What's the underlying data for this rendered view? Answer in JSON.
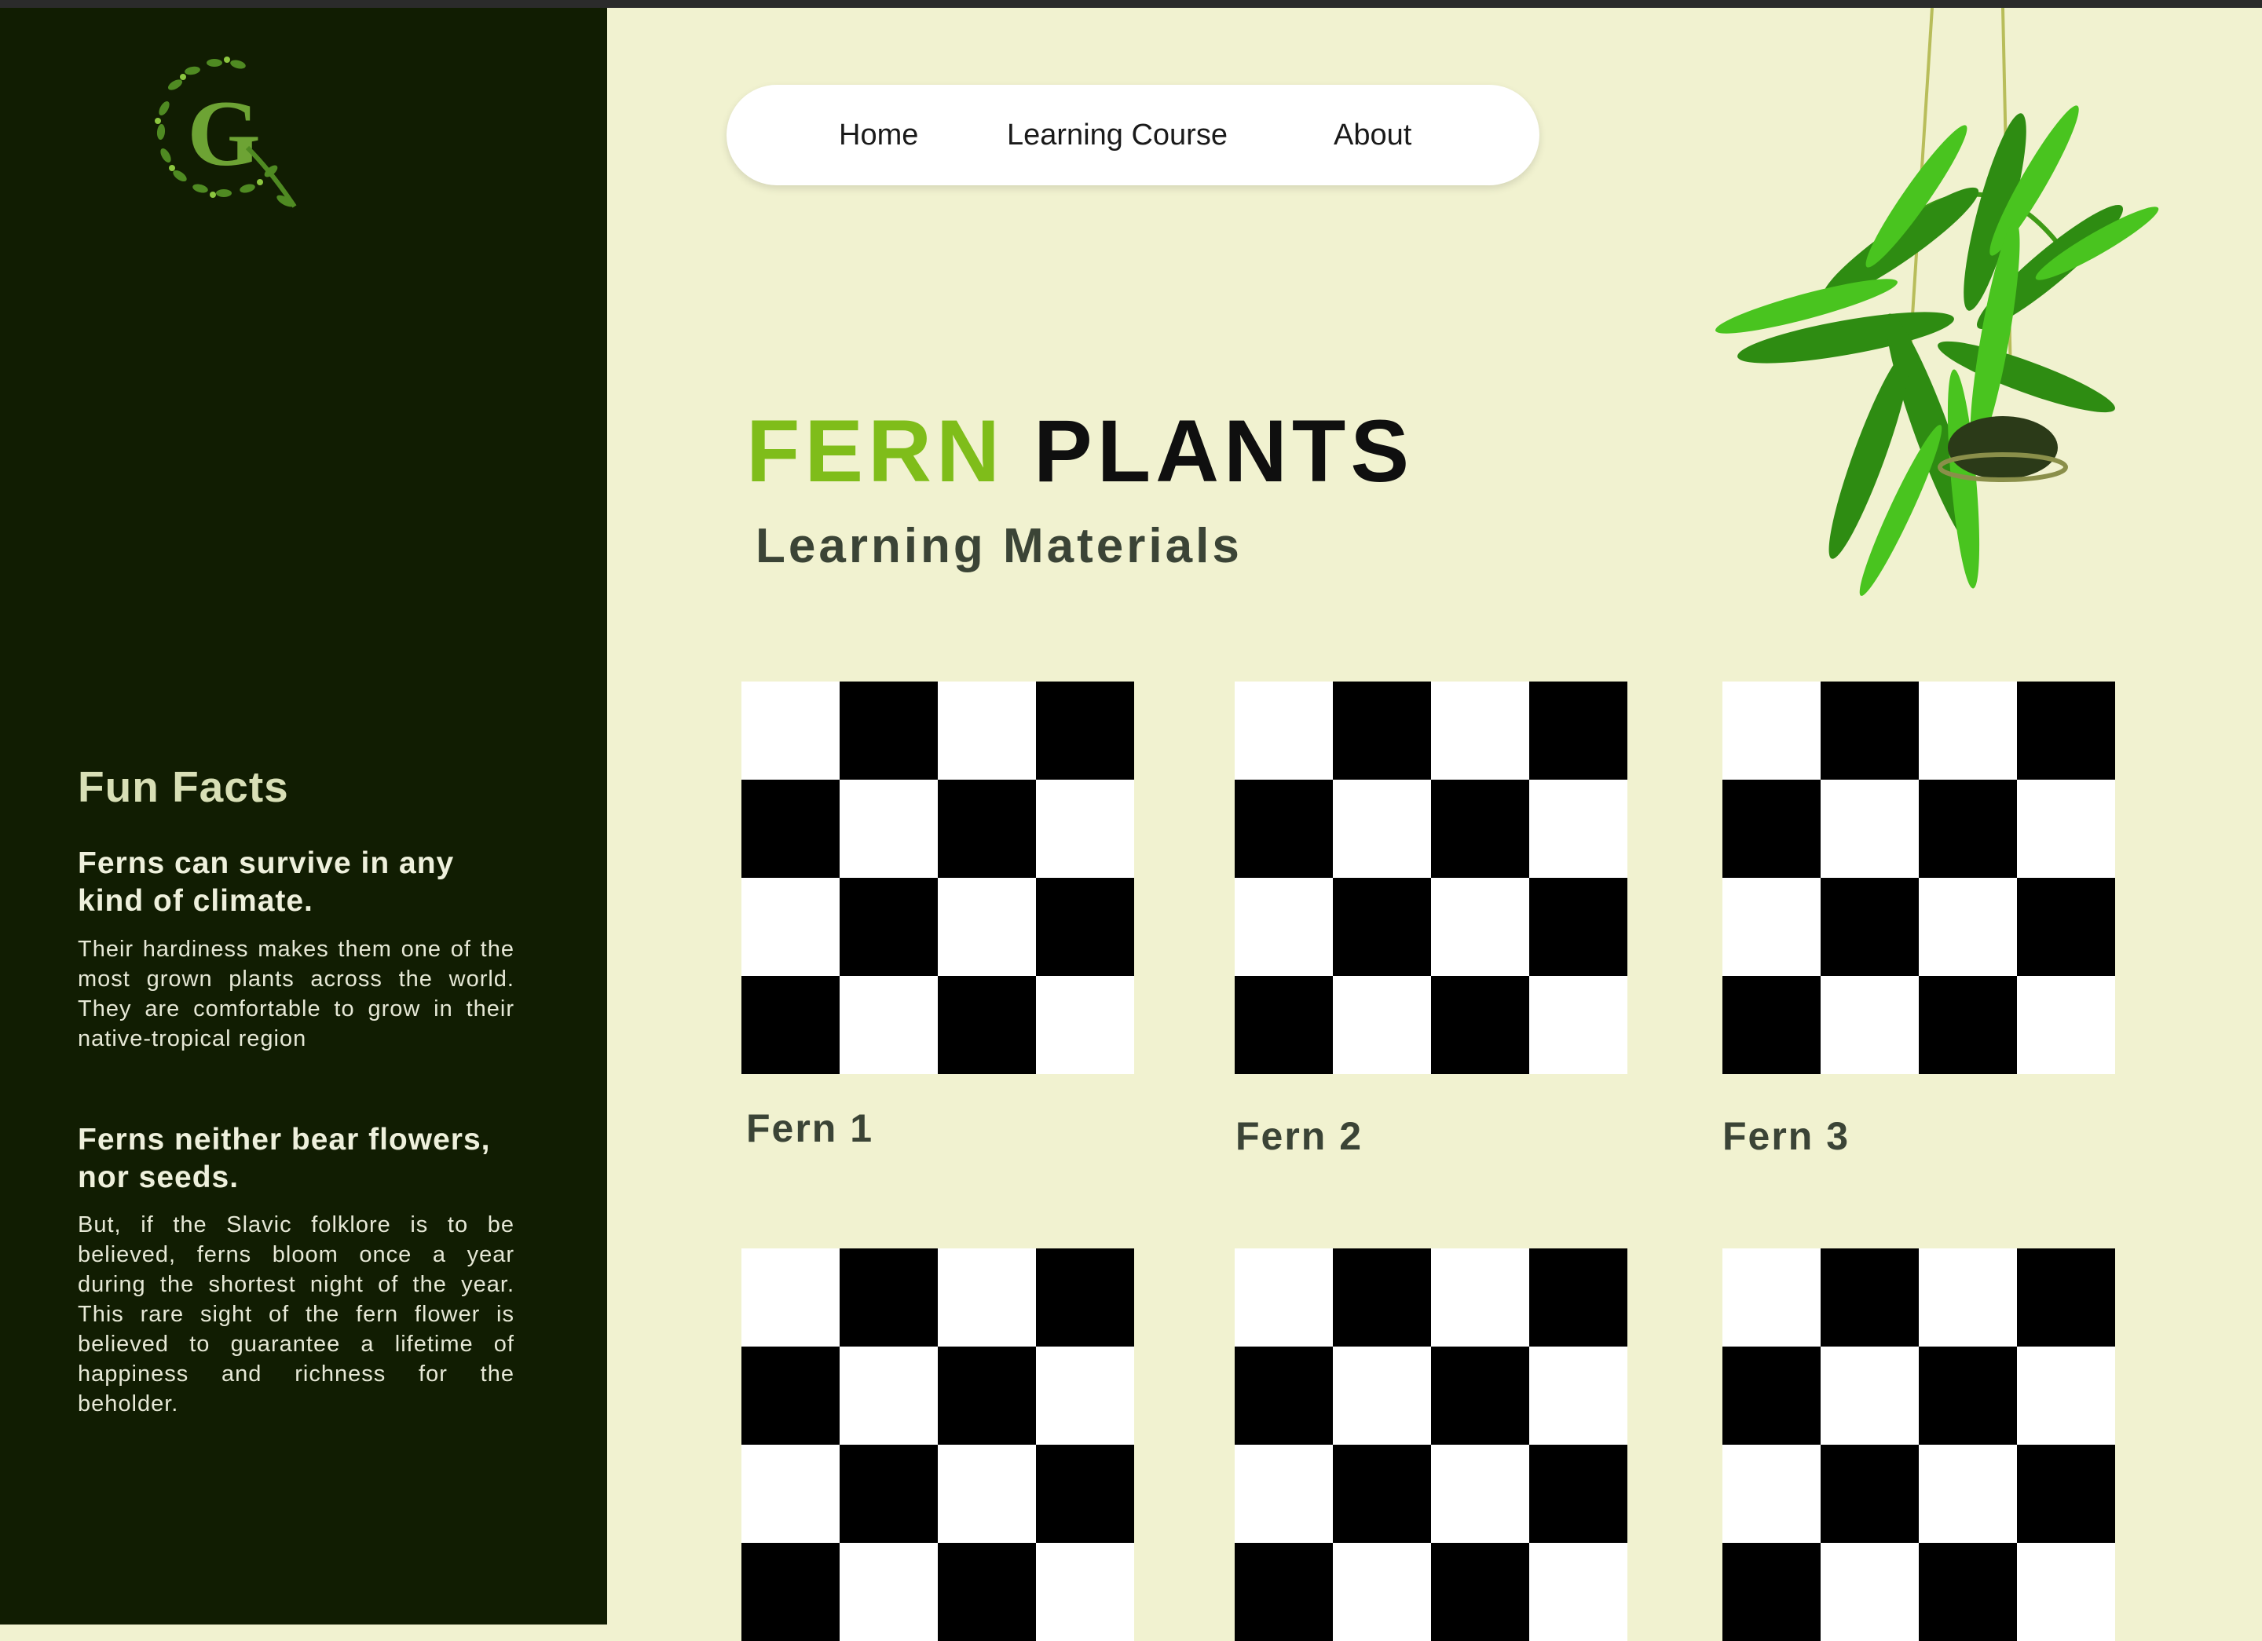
{
  "nav": {
    "items": [
      "Home",
      "Learning Course",
      "About"
    ]
  },
  "hero": {
    "title_accent": "FERN",
    "title_main": "PLANTS",
    "subtitle": "Learning Materials"
  },
  "sidebar": {
    "logo_letter": "G",
    "fun_facts_title": "Fun Facts",
    "facts": [
      {
        "heading": "Ferns can survive in any kind of climate.",
        "body": "Their hardiness makes them one of the most grown plants across the world. They are comfortable to grow in their native-tropical region"
      },
      {
        "heading": "Ferns neither bear flowers, nor seeds.",
        "body": "But, if the Slavic folklore is to be believed, ferns bloom once a year during the shortest night of the year. This rare sight of the fern flower is believed to guarantee a lifetime of happiness and richness for the beholder."
      }
    ]
  },
  "cards": [
    {
      "label": "Fern 1"
    },
    {
      "label": "Fern 2"
    },
    {
      "label": "Fern 3"
    },
    {
      "label": ""
    },
    {
      "label": ""
    },
    {
      "label": ""
    }
  ],
  "colors": {
    "sidebar_bg": "#111d02",
    "page_bg": "#f1f2d0",
    "accent_green": "#7fbd1a",
    "nav_bg": "#ffffff"
  },
  "icons": {
    "logo": "fern-g-logo-icon",
    "plant": "hanging-fern-image"
  }
}
